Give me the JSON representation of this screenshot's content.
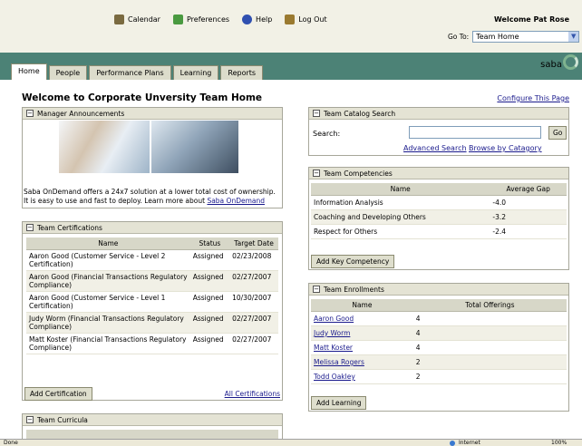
{
  "topnav": {
    "items": [
      {
        "label": "Calendar",
        "icon": "calendar-icon",
        "color": "#7a6a40"
      },
      {
        "label": "Preferences",
        "icon": "preferences-icon",
        "color": "#4a9a40"
      },
      {
        "label": "Help",
        "icon": "help-icon",
        "color": "#3050b0"
      },
      {
        "label": "Log Out",
        "icon": "logout-icon",
        "color": "#9a7a30"
      }
    ],
    "welcome": "Welcome Pat Rose",
    "goto_label": "Go To:",
    "goto_value": "Team Home"
  },
  "tabs": [
    "Home",
    "People",
    "Performance Plans",
    "Learning",
    "Reports"
  ],
  "logo": "saba",
  "page": {
    "title": "Welcome to Corporate Unversity Team Home",
    "configure": "Configure This Page"
  },
  "announcements": {
    "title": "Manager Announcements",
    "text": "Saba OnDemand offers a 24x7 solution at a lower total cost of ownership. It is easy to use and fast to deploy. Learn more about ",
    "link": "Saba OnDemand"
  },
  "certifications": {
    "title": "Team Certifications",
    "columns": [
      "Name",
      "Status",
      "Target Date"
    ],
    "rows": [
      {
        "name": "Aaron Good (Customer Service - Level 2 Certification)",
        "status": "Assigned",
        "date": "02/23/2008"
      },
      {
        "name": "Aaron Good (Financial Transactions Regulatory Compliance)",
        "status": "Assigned",
        "date": "02/27/2007"
      },
      {
        "name": "Aaron Good (Customer Service - Level 1 Certification)",
        "status": "Assigned",
        "date": "10/30/2007"
      },
      {
        "name": "Judy Worm (Financial Transactions Regulatory Compliance)",
        "status": "Assigned",
        "date": "02/27/2007"
      },
      {
        "name": "Matt Koster (Financial Transactions Regulatory Compliance)",
        "status": "Assigned",
        "date": "02/27/2007"
      }
    ],
    "add_button": "Add Certification",
    "all_link": "All Certifications"
  },
  "curricula": {
    "title": "Team Curricula"
  },
  "catalog": {
    "title": "Team Catalog Search",
    "label": "Search:",
    "go": "Go",
    "advanced": "Advanced Search",
    "browse": "Browse by Catagory"
  },
  "competencies": {
    "title": "Team Competencies",
    "columns": [
      "Name",
      "Average Gap"
    ],
    "rows": [
      {
        "name": "Information Analysis",
        "gap": "-4.0"
      },
      {
        "name": "Coaching and Developing Others",
        "gap": "-3.2"
      },
      {
        "name": "Respect for Others",
        "gap": "-2.4"
      }
    ],
    "add_button": "Add Key Competency"
  },
  "enrollments": {
    "title": "Team Enrollments",
    "columns": [
      "Name",
      "Total Offerings"
    ],
    "rows": [
      {
        "name": "Aaron Good",
        "count": "4"
      },
      {
        "name": "Judy Worm",
        "count": "4"
      },
      {
        "name": "Matt Koster",
        "count": "4"
      },
      {
        "name": "Melissa Rogers",
        "count": "2"
      },
      {
        "name": "Todd Oakley",
        "count": "2"
      }
    ],
    "add_button": "Add Learning"
  },
  "statusbar": {
    "left": "Done",
    "zone": "Internet",
    "zoom": "100%"
  }
}
